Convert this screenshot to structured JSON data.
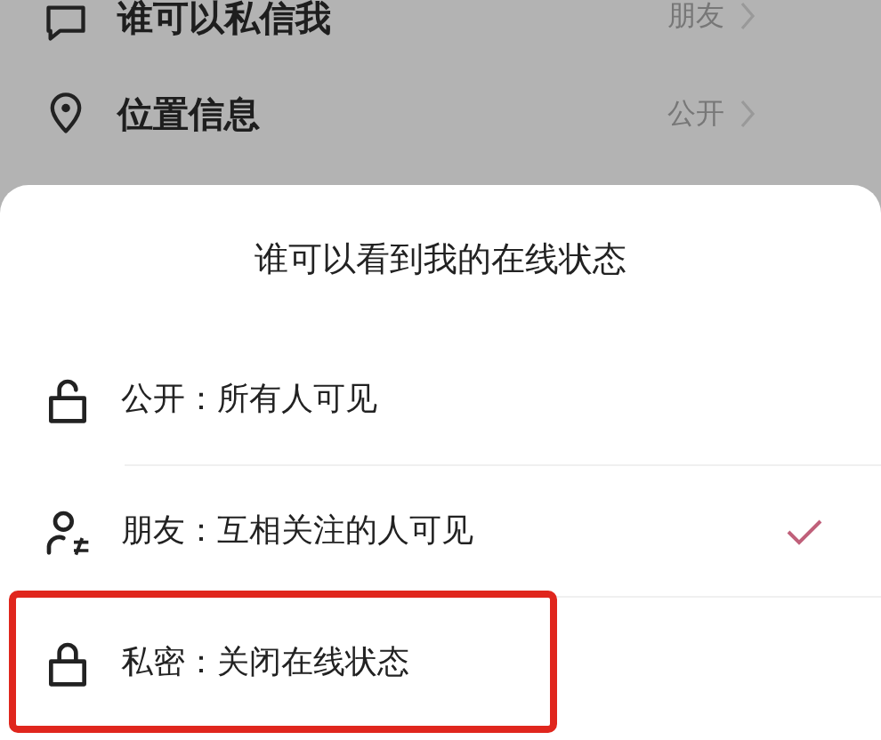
{
  "settings": [
    {
      "label": "谁可以私信我",
      "value": "朋友"
    },
    {
      "label": "位置信息",
      "value": "公开"
    }
  ],
  "sheet": {
    "title": "谁可以看到我的在线状态",
    "options": [
      {
        "label": "公开：所有人可见",
        "selected": false,
        "highlighted": false
      },
      {
        "label": "朋友：互相关注的人可见",
        "selected": true,
        "highlighted": false
      },
      {
        "label": "私密：关闭在线状态",
        "selected": false,
        "highlighted": true
      }
    ]
  }
}
